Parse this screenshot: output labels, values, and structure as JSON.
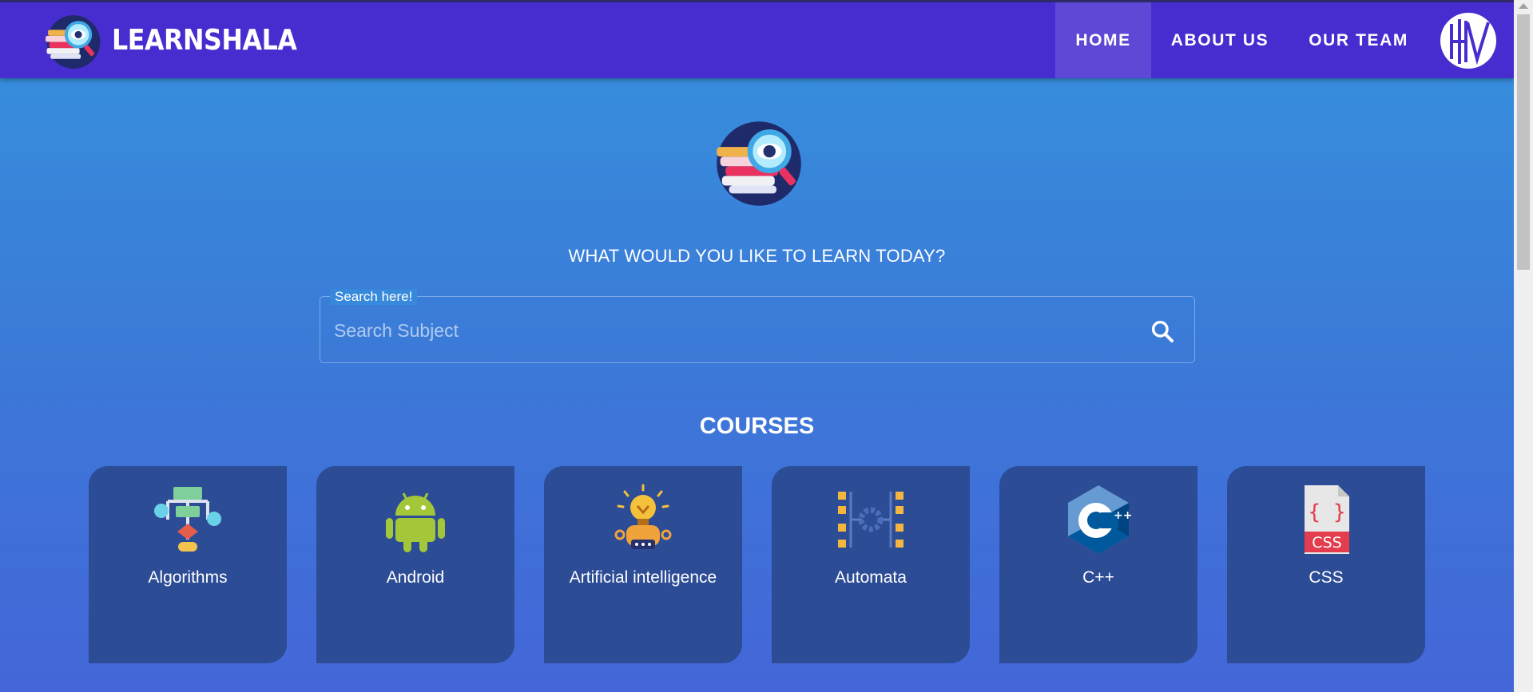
{
  "brand": {
    "name": "LEARNSHALA",
    "logo_icon": "books-magnifier-logo-icon"
  },
  "nav": {
    "items": [
      {
        "label": "HOME",
        "active": true
      },
      {
        "label": "ABOUT US",
        "active": false
      },
      {
        "label": "OUR TEAM",
        "active": false
      }
    ],
    "avatar_icon": "user-avatar-icon"
  },
  "hero": {
    "question": "WHAT WOULD YOU LIKE TO LEARN TODAY?",
    "search": {
      "legend": "Search here!",
      "placeholder": "Search Subject",
      "value": "",
      "icon": "search-icon"
    }
  },
  "courses": {
    "title": "COURSES",
    "items": [
      {
        "label": "Algorithms",
        "icon": "flowchart-icon"
      },
      {
        "label": "Android",
        "icon": "android-icon"
      },
      {
        "label": "Artificial intelligence",
        "icon": "lightbulb-robot-icon"
      },
      {
        "label": "Automata",
        "icon": "automata-gear-icon"
      },
      {
        "label": "C++",
        "icon": "cpp-icon"
      },
      {
        "label": "CSS",
        "icon": "css-file-icon"
      }
    ]
  },
  "colors": {
    "navbar": "#472dcf",
    "card": "#2c4c96",
    "background_top": "#3592dd",
    "background_bottom": "#4466d8"
  }
}
